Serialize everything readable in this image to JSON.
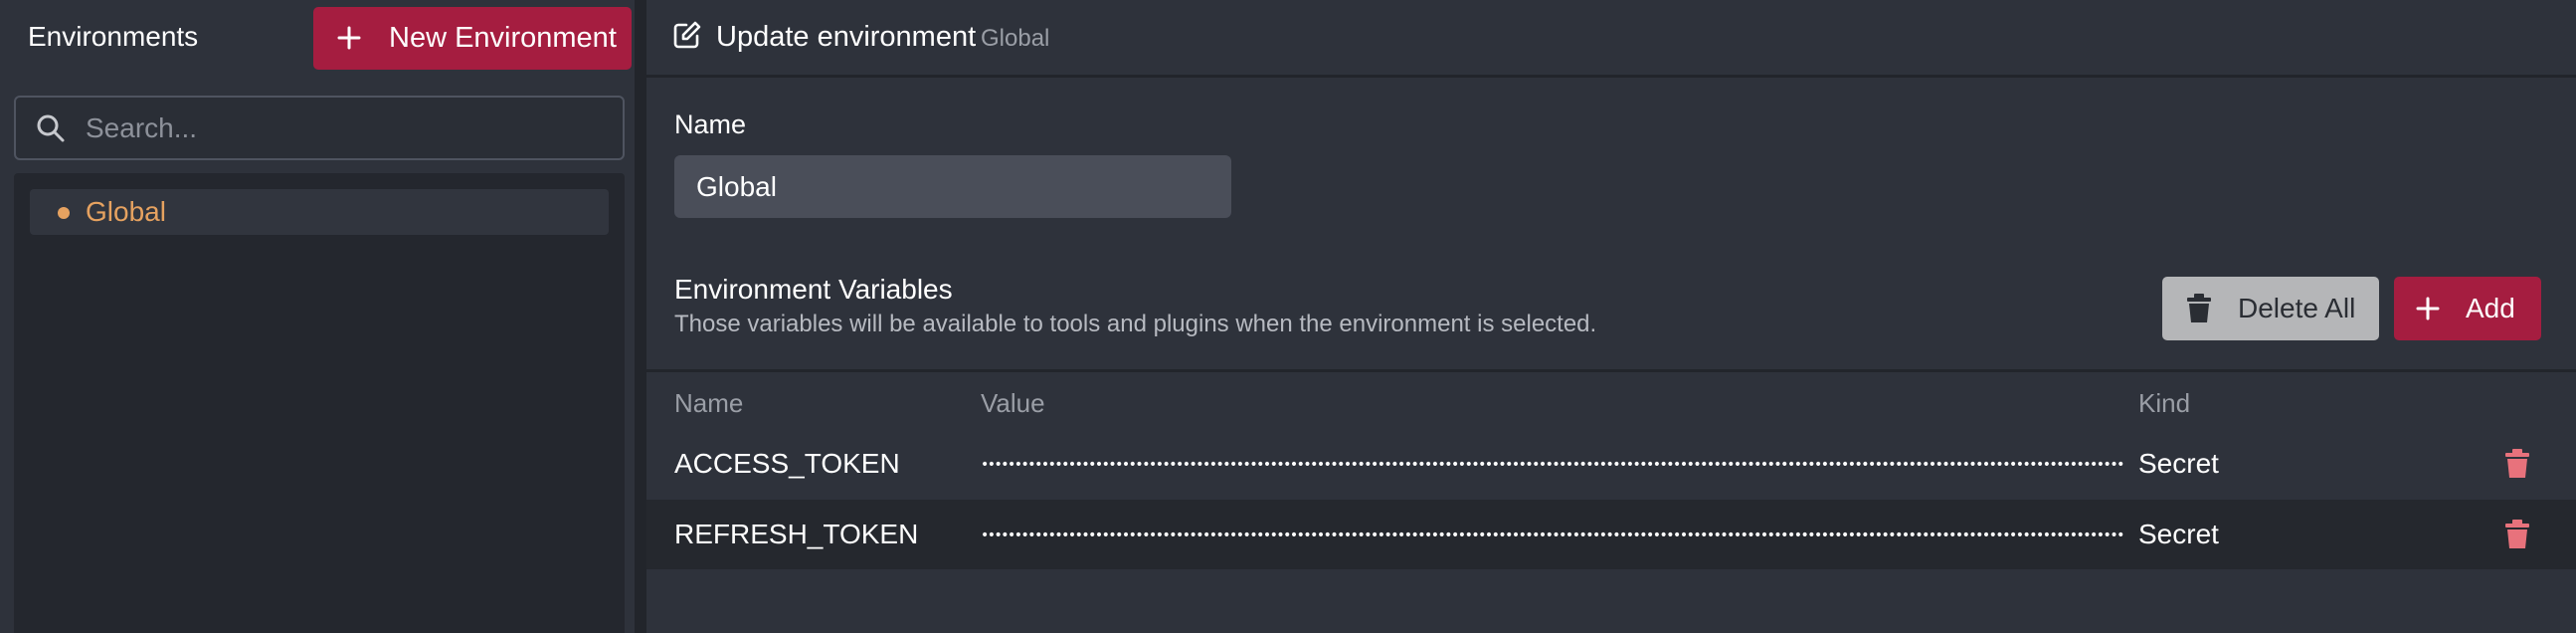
{
  "sidebar": {
    "title": "Environments",
    "new_button_label": "New Environment",
    "search_placeholder": "Search...",
    "environments": [
      {
        "label": "Global",
        "dot_color": "#e6a260",
        "selected": true
      }
    ]
  },
  "main": {
    "header": {
      "title": "Update environment",
      "subtitle": "Global",
      "icon": "edit-icon"
    },
    "name_label": "Name",
    "name_value": "Global",
    "variables": {
      "title": "Environment Variables",
      "description": "Those variables will be available to tools and plugins when the environment is selected.",
      "delete_all_label": "Delete All",
      "add_label": "Add",
      "columns": [
        "Name",
        "Value",
        "Kind"
      ],
      "rows": [
        {
          "name": "ACCESS_TOKEN",
          "value": "••••••••••••••••••••••••••••••••••••••••••••••••••••••••••••••••••••••••••••••••••••••••••••••••••••••••••••••••••••••••••••••••••••••••••••••••••••••••••••••••••••••••••••••••••••••••••••••••••••••••••••••••",
          "kind": "Secret"
        },
        {
          "name": "REFRESH_TOKEN",
          "value": "••••••••••••••••••••••••••••••••••••••••••••••••••••••••••••••••••••••••••••••••••••••••••••••••••••••••••••••••••••••••••••••••••••••••••••••••••••••••••••••••••••••••••••••••••••••••••••••••••••••••••••••",
          "kind": "Secret"
        }
      ]
    }
  },
  "colors": {
    "accent": "#a51d40",
    "env_dot": "#e6a260",
    "delete_icon": "#e8727c",
    "background": "#2e323b"
  }
}
